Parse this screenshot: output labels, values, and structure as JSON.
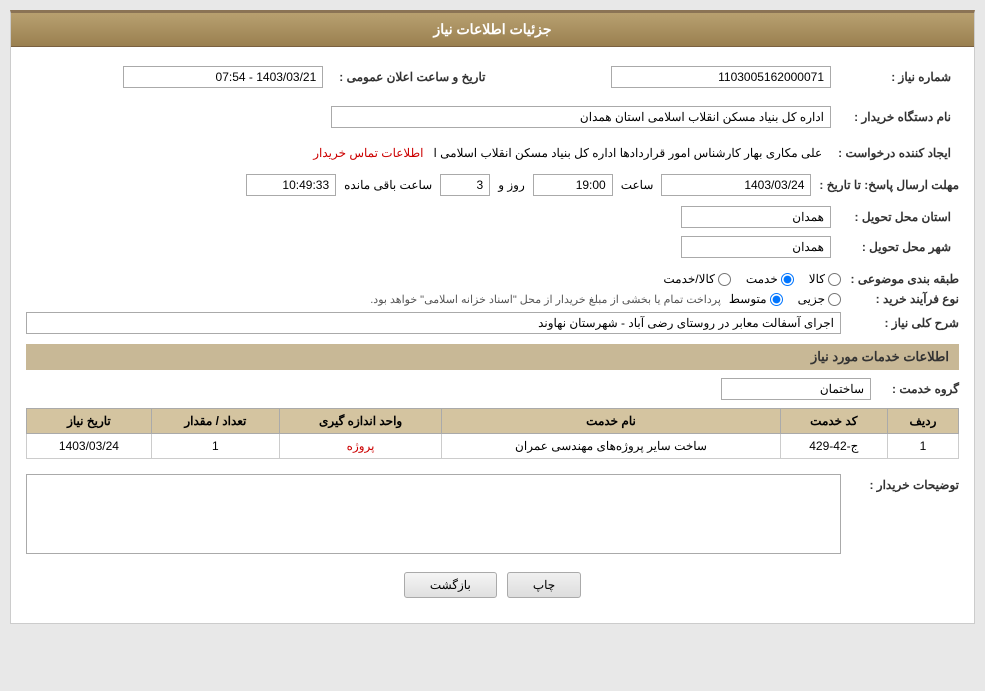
{
  "header": {
    "title": "جزئیات اطلاعات نیاز"
  },
  "fields": {
    "need_number_label": "شماره نیاز :",
    "need_number_value": "1103005162000071",
    "buyer_org_label": "نام دستگاه خریدار :",
    "buyer_org_value": "اداره کل بنیاد مسکن انقلاب اسلامی استان همدان",
    "creator_label": "ایجاد کننده درخواست :",
    "creator_value": "علی مکاری بهار کارشناس امور قراردادها اداره کل بنیاد مسکن انقلاب اسلامی ا",
    "creator_link": "اطلاعات تماس خریدار",
    "reply_date_label": "مهلت ارسال پاسخ: تا تاریخ :",
    "reply_date_value": "1403/03/24",
    "reply_time_label": "ساعت",
    "reply_time_value": "19:00",
    "reply_days_label": "روز و",
    "reply_days_value": "3",
    "reply_remaining_label": "ساعت باقی مانده",
    "reply_remaining_value": "10:49:33",
    "announce_date_label": "تاریخ و ساعت اعلان عمومی :",
    "announce_date_value": "1403/03/21 - 07:54",
    "province_label": "استان محل تحویل :",
    "province_value": "همدان",
    "city_label": "شهر محل تحویل :",
    "city_value": "همدان",
    "category_label": "طبقه بندی موضوعی :",
    "category_options": [
      {
        "id": "kala",
        "label": "کالا"
      },
      {
        "id": "khedmat",
        "label": "خدمت"
      },
      {
        "id": "kala_khedmat",
        "label": "کالا/خدمت"
      }
    ],
    "category_selected": "khedmat",
    "process_label": "نوع فرآیند خرید :",
    "process_options": [
      {
        "id": "jozyi",
        "label": "جزیی"
      },
      {
        "id": "motevaset",
        "label": "متوسط"
      }
    ],
    "process_selected": "motevaset",
    "process_note": "پرداخت تمام یا بخشی از مبلغ خریدار از محل \"اسناد خزانه اسلامی\" خواهد بود.",
    "description_label": "شرح کلی نیاز :",
    "description_value": "اجرای آسفالت معابر در روستای رضی آباد - شهرستان نهاوند"
  },
  "services_section": {
    "title": "اطلاعات خدمات مورد نیاز",
    "group_label": "گروه خدمت :",
    "group_value": "ساختمان",
    "table": {
      "headers": [
        "ردیف",
        "کد خدمت",
        "نام خدمت",
        "واحد اندازه گیری",
        "تعداد / مقدار",
        "تاریخ نیاز"
      ],
      "rows": [
        {
          "row_num": "1",
          "service_code": "ج-42-429",
          "service_name": "ساخت سایر پروژه‌های مهندسی عمران",
          "unit": "پروژه",
          "quantity": "1",
          "date": "1403/03/24"
        }
      ]
    }
  },
  "buyer_desc_label": "توضیحات خریدار :",
  "buttons": {
    "print_label": "چاپ",
    "back_label": "بازگشت"
  }
}
